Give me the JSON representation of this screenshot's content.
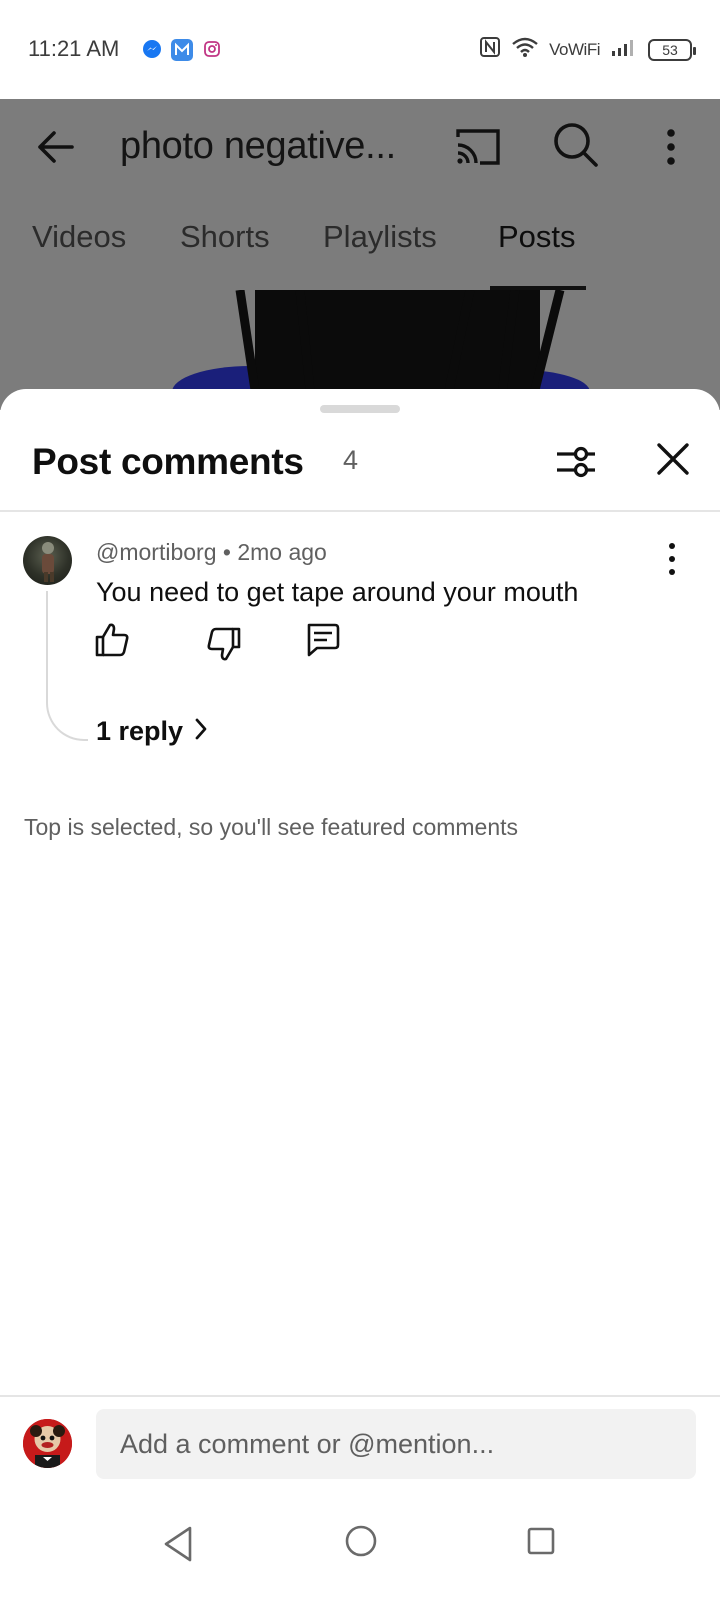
{
  "status_bar": {
    "time": "11:21 AM",
    "apps": [
      "messenger-icon",
      "mail-icon",
      "instagram-icon"
    ],
    "network_label": "VoWiFi",
    "battery": "53"
  },
  "channel": {
    "title": "photo negative...",
    "tabs": [
      {
        "label": "Videos",
        "active": false
      },
      {
        "label": "Shorts",
        "active": false
      },
      {
        "label": "Playlists",
        "active": false
      },
      {
        "label": "Posts",
        "active": true
      }
    ]
  },
  "comments_sheet": {
    "title": "Post comments",
    "count": "4",
    "comments": [
      {
        "author": "@mortiborg",
        "time": "2mo ago",
        "text": "You need to get tape around your mouth",
        "replies_label": "1 reply"
      }
    ],
    "sort_note": "Top is selected, so you'll see featured comments"
  },
  "composer": {
    "placeholder": "Add a comment or @mention..."
  },
  "colors": {
    "overlay": "#7c7c7c",
    "sheet_bg": "#ffffff",
    "secondary_text": "#606060",
    "input_bg": "#f2f2f2"
  }
}
